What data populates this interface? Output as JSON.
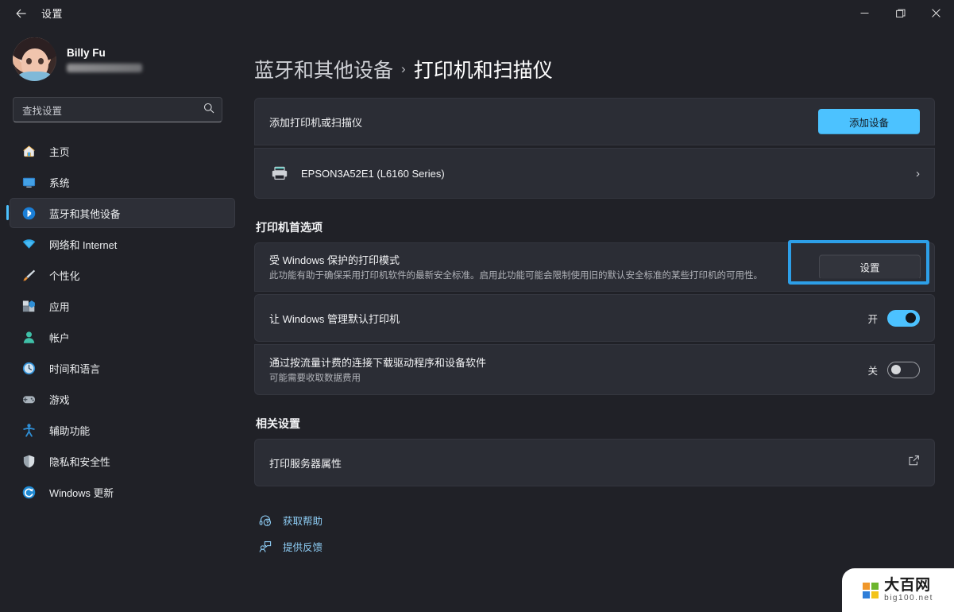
{
  "window": {
    "title": "设置",
    "back_icon": "arrow-left-icon",
    "controls": {
      "minimize": "−",
      "maximize": "❐",
      "close": "✕"
    }
  },
  "sidebar": {
    "profile": {
      "name": "Billy Fu",
      "email_masked": ""
    },
    "search": {
      "placeholder": "查找设置",
      "icon": "search-icon"
    },
    "items": [
      {
        "label": "主页",
        "icon": "home-icon",
        "selected": false
      },
      {
        "label": "系统",
        "icon": "system-icon",
        "selected": false
      },
      {
        "label": "蓝牙和其他设备",
        "icon": "bluetooth-icon",
        "selected": true
      },
      {
        "label": "网络和 Internet",
        "icon": "wifi-icon",
        "selected": false
      },
      {
        "label": "个性化",
        "icon": "brush-icon",
        "selected": false
      },
      {
        "label": "应用",
        "icon": "apps-icon",
        "selected": false
      },
      {
        "label": "帐户",
        "icon": "account-icon",
        "selected": false
      },
      {
        "label": "时间和语言",
        "icon": "clock-icon",
        "selected": false
      },
      {
        "label": "游戏",
        "icon": "gamepad-icon",
        "selected": false
      },
      {
        "label": "辅助功能",
        "icon": "accessibility-icon",
        "selected": false
      },
      {
        "label": "隐私和安全性",
        "icon": "shield-icon",
        "selected": false
      },
      {
        "label": "Windows 更新",
        "icon": "update-icon",
        "selected": false
      }
    ]
  },
  "breadcrumb": {
    "parent": "蓝牙和其他设备",
    "separator": "›",
    "current": "打印机和扫描仪"
  },
  "main": {
    "add_printer": {
      "label": "添加打印机或扫描仪",
      "button": "添加设备"
    },
    "printer": {
      "name": "EPSON3A52E1 (L6160 Series)",
      "icon": "printer-icon",
      "chevron": "›"
    },
    "preferences_heading": "打印机首选项",
    "protected_print": {
      "title": "受 Windows 保护的打印模式",
      "description": "此功能有助于确保采用打印机软件的最新安全标准。启用此功能可能会限制使用旧的默认安全标准的某些打印机的可用性。",
      "button": "设置",
      "highlighted": true,
      "highlight_color": "#2d9fe8"
    },
    "manage_default": {
      "title": "让 Windows 管理默认打印机",
      "state_label": "开",
      "state_on": true
    },
    "metered_download": {
      "title": "通过按流量计费的连接下载驱动程序和设备软件",
      "description": "可能需要收取数据费用",
      "state_label": "关",
      "state_on": false
    },
    "related_heading": "相关设置",
    "print_server": {
      "label": "打印服务器属性",
      "icon": "external-link-icon"
    },
    "links": [
      {
        "label": "获取帮助",
        "icon": "help-icon"
      },
      {
        "label": "提供反馈",
        "icon": "feedback-icon"
      }
    ]
  },
  "watermark": {
    "cn": "大百网",
    "en": "big100.net"
  },
  "colors": {
    "accent": "#4cc2ff",
    "highlight": "#2d9fe8",
    "card": "#2b2d35",
    "page": "#202127"
  }
}
